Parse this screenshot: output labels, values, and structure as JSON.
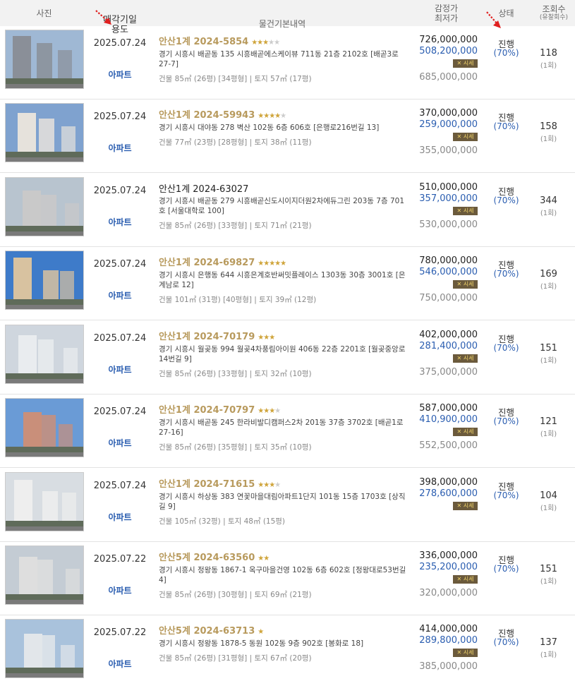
{
  "headers": {
    "photo": "사진",
    "date_line1": "매각기일",
    "date_line2": "용도",
    "info": "물건기본내역",
    "price_line1": "감정가",
    "price_line2": "최저가",
    "status": "상태",
    "views_line1": "조회수",
    "views_line2": "(유찰회수)"
  },
  "market_label": "시세",
  "rows": [
    {
      "date": "2025.07.24",
      "use": "아파트",
      "case_no": "안산1계 2024-5854",
      "stars": 3,
      "stars_total": 5,
      "address": "경기 시흥시 배곧동 135 시흥배곧에스케이뷰 711동 21층 2102호 [배곧3로 27-7]",
      "size": "건물 85㎡ (26평) [34평형]  |  토지 57㎡ (17평)",
      "appraisal": "726,000,000",
      "minimum": "508,200,000",
      "prev": "685,000,000",
      "status": "진행",
      "percent": "(70%)",
      "views": "118",
      "fails": "(1회)",
      "highlight": true
    },
    {
      "date": "2025.07.24",
      "use": "아파트",
      "case_no": "안산1계 2024-59943",
      "stars": 4,
      "stars_total": 5,
      "address": "경기 시흥시 대야동 278 벽산 102동 6층 606호 [은행로216번길 13]",
      "size": "건물 77㎡ (23평) [28평형]  |  토지 38㎡ (11평)",
      "appraisal": "370,000,000",
      "minimum": "259,000,000",
      "prev": "355,000,000",
      "status": "진행",
      "percent": "(70%)",
      "views": "158",
      "fails": "(1회)",
      "highlight": true
    },
    {
      "date": "2025.07.24",
      "use": "아파트",
      "case_no": "안산1계 2024-63027",
      "stars": 0,
      "stars_total": 0,
      "address": "경기 시흥시 배곧동 279 시흥배곧신도시이지더원2차에듀그린 203동 7층 701호 [서울대학로 100]",
      "size": "건물 85㎡ (26평) [33평형]  |  토지 71㎡ (21평)",
      "appraisal": "510,000,000",
      "minimum": "357,000,000",
      "prev": "530,000,000",
      "status": "진행",
      "percent": "(70%)",
      "views": "344",
      "fails": "(1회)",
      "highlight": false
    },
    {
      "date": "2025.07.24",
      "use": "아파트",
      "case_no": "안산1계 2024-69827",
      "stars": 5,
      "stars_total": 5,
      "address": "경기 시흥시 은행동 644 시흥은계호반써밋플레이스 1303동 30층 3001호 [은계남로 12]",
      "size": "건물 101㎡ (31평) [40평형]  |  토지 39㎡ (12평)",
      "appraisal": "780,000,000",
      "minimum": "546,000,000",
      "prev": "750,000,000",
      "status": "진행",
      "percent": "(70%)",
      "views": "169",
      "fails": "(1회)",
      "highlight": true
    },
    {
      "date": "2025.07.24",
      "use": "아파트",
      "case_no": "안산1계 2024-70179",
      "stars": 3,
      "stars_total": 3,
      "address": "경기 시흥시 월곶동 994 월곶4차풍림아이원 406동 22층 2201호 [월곶중앙로14번길 9]",
      "size": "건물 85㎡ (26평) [33평형]  |  토지 32㎡ (10평)",
      "appraisal": "402,000,000",
      "minimum": "281,400,000",
      "prev": "375,000,000",
      "status": "진행",
      "percent": "(70%)",
      "views": "151",
      "fails": "(1회)",
      "highlight": true
    },
    {
      "date": "2025.07.24",
      "use": "아파트",
      "case_no": "안산1계 2024-70797",
      "stars": 3,
      "stars_total": 4,
      "address": "경기 시흥시 배곧동 245 한라비발디캠퍼스2차 201동 37층 3702호 [배곧1로 27-16]",
      "size": "건물 85㎡ (26평) [35평형]  |  토지 35㎡ (10평)",
      "appraisal": "587,000,000",
      "minimum": "410,900,000",
      "prev": "552,500,000",
      "status": "진행",
      "percent": "(70%)",
      "views": "121",
      "fails": "(1회)",
      "highlight": true
    },
    {
      "date": "2025.07.24",
      "use": "아파트",
      "case_no": "안산1계 2024-71615",
      "stars": 3,
      "stars_total": 4,
      "address": "경기 시흥시 하상동 383 연꽃마을대림아파트1단지 101동 15층 1703호 [상직길 9]",
      "size": "건물 105㎡ (32평)  |  토지 48㎡ (15평)",
      "appraisal": "398,000,000",
      "minimum": "278,600,000",
      "prev": "",
      "status": "진행",
      "percent": "(70%)",
      "views": "104",
      "fails": "(1회)",
      "highlight": true
    },
    {
      "date": "2025.07.22",
      "use": "아파트",
      "case_no": "안산5계 2024-63560",
      "stars": 2,
      "stars_total": 2,
      "address": "경기 시흥시 정왕동 1867-1 옥구마을건영 102동 6층 602호 [정왕대로53번길 4]",
      "size": "건물 85㎡ (26평) [30평형]  |  토지 69㎡ (21평)",
      "appraisal": "336,000,000",
      "minimum": "235,200,000",
      "prev": "320,000,000",
      "status": "진행",
      "percent": "(70%)",
      "views": "151",
      "fails": "(1회)",
      "highlight": true
    },
    {
      "date": "2025.07.22",
      "use": "아파트",
      "case_no": "안산5계 2024-63713",
      "stars": 1,
      "stars_total": 1,
      "address": "경기 시흥시 정왕동 1878-5 동원 102동 9층 902호 [봉화로 18]",
      "size": "건물 85㎡ (26평) [31평형]  |  토지 67㎡ (20평)",
      "appraisal": "414,000,000",
      "minimum": "289,800,000",
      "prev": "385,000,000",
      "status": "진행",
      "percent": "(70%)",
      "views": "137",
      "fails": "(1회)",
      "highlight": true
    }
  ]
}
